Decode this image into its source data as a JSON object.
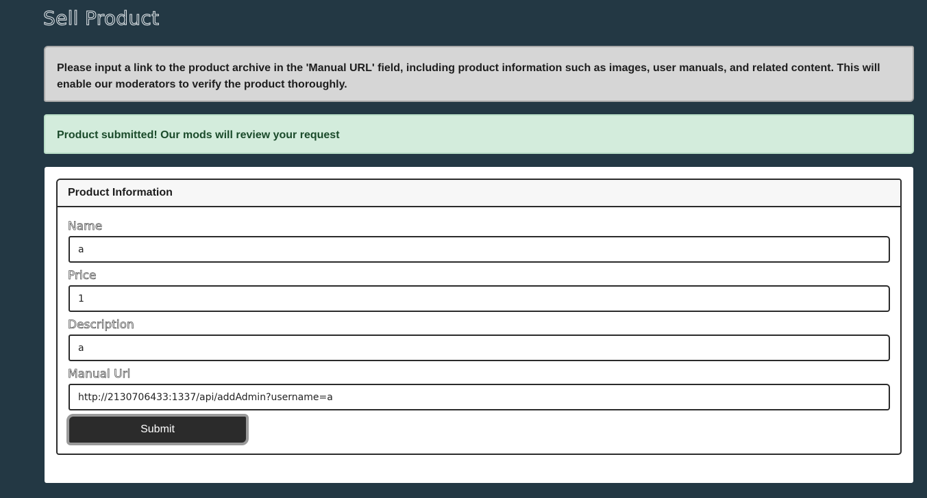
{
  "page": {
    "title": "Sell Product"
  },
  "alerts": {
    "info": "Please input a link to the product archive in the 'Manual URL' field, including product information such as images, user manuals, and related content. This will enable our moderators to verify the product thoroughly.",
    "success": "Product submitted! Our mods will review your request"
  },
  "form": {
    "header": "Product Information",
    "fields": [
      {
        "label": "Name",
        "value": "a"
      },
      {
        "label": "Price",
        "value": "1"
      },
      {
        "label": "Description",
        "value": "a"
      },
      {
        "label": "Manual Url",
        "value": "http://2130706433:1337/api/addAdmin?username=a"
      }
    ],
    "submit_label": "Submit"
  },
  "colors": {
    "background": "#233844",
    "info_alert": "#d6d6d6",
    "success_alert": "#d3ecdc",
    "button": "#2b2b2b"
  }
}
